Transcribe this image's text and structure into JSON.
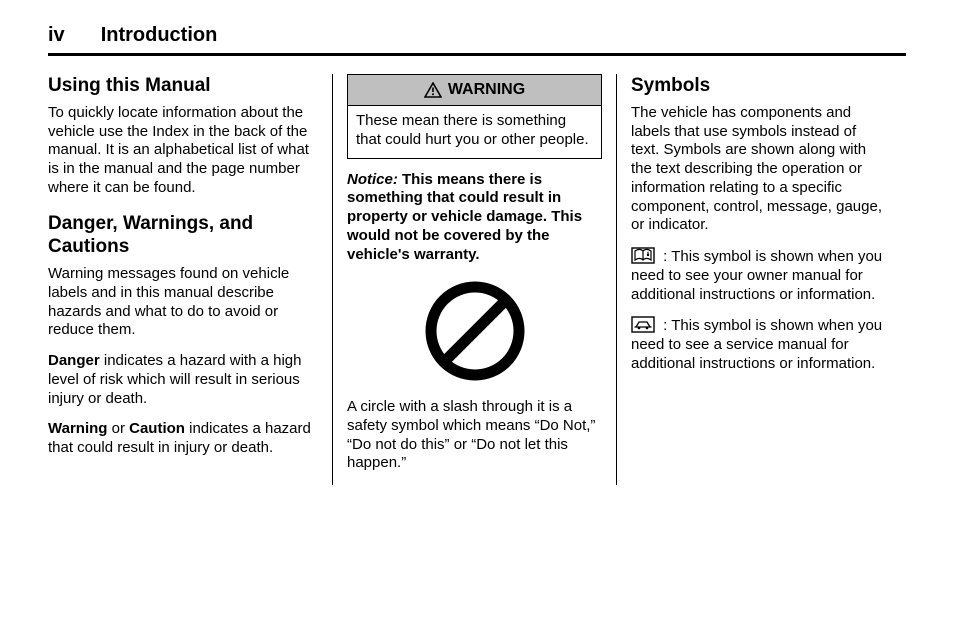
{
  "header": {
    "page": "iv",
    "title": "Introduction"
  },
  "col1": {
    "h1": "Using this Manual",
    "p1": "To quickly locate information about the vehicle use the Index in the back of the manual. It is an alphabetical list of what is in the manual and the page number where it can be found.",
    "h2": "Danger, Warnings, and Cautions",
    "p2": "Warning messages found on vehicle labels and in this manual describe hazards and what to do to avoid or reduce them.",
    "p3a": "Danger",
    "p3b": " indicates a hazard with a high level of risk which will result in serious injury or death.",
    "p4a": "Warning",
    "p4b": " or ",
    "p4c": "Caution",
    "p4d": " indicates a hazard that could result in injury or death."
  },
  "col2": {
    "warning_label": "WARNING",
    "warning_body": "These mean there is something that could hurt you or other people.",
    "notice_lead": "Notice:",
    "notice_body": " This means there is something that could result in property or vehicle damage. This would not be covered by the vehicle's warranty.",
    "circle_caption": "A circle with a slash through it is a safety symbol which means “Do Not,” “Do not do this” or “Do not let this happen.”"
  },
  "col3": {
    "h1": "Symbols",
    "p1": "The vehicle has components and labels that use symbols instead of text. Symbols are shown along with the text describing the operation or information relating to a specific component, control, message, gauge, or indicator.",
    "sym1": " :  This symbol is shown when you need to see your owner manual for additional instructions or information.",
    "sym2": " :  This symbol is shown when you need to see a service manual for additional instructions or information."
  }
}
